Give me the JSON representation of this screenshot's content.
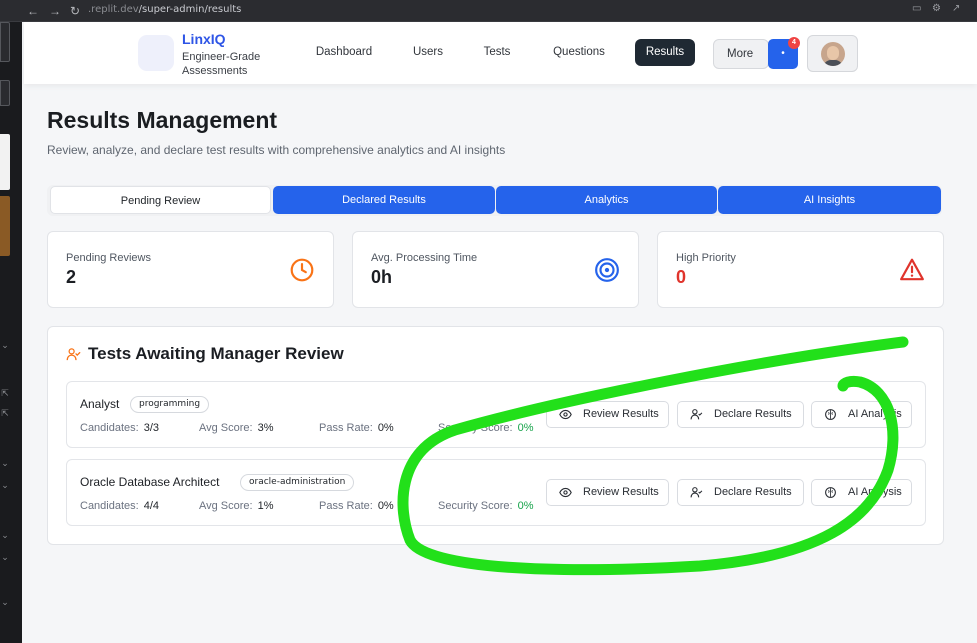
{
  "browser": {
    "url_prefix": ".replit.dev",
    "url_path": "/super-admin/results"
  },
  "brand": {
    "name": "LinxIQ",
    "tagline": "Engineer-Grade Assessments"
  },
  "nav": {
    "items": [
      "Dashboard",
      "Users",
      "Tests",
      "Questions",
      "Results"
    ],
    "active": "Results",
    "more_label": "More",
    "notification_count": "4",
    "notification_glyph": "•"
  },
  "page": {
    "title": "Results Management",
    "subtitle": "Review, analyze, and declare test results with comprehensive analytics and AI insights"
  },
  "tabs": [
    "Pending Review",
    "Declared Results",
    "Analytics",
    "AI Insights"
  ],
  "stats": [
    {
      "label": "Pending Reviews",
      "value": "2",
      "icon": "clock-icon",
      "color": "#f97316"
    },
    {
      "label": "Avg. Processing Time",
      "value": "0h",
      "icon": "target-icon",
      "color": "#2563eb"
    },
    {
      "label": "High Priority",
      "value": "0",
      "icon": "alert-triangle-icon",
      "color": "#e0342c"
    }
  ],
  "panel": {
    "title": "Tests Awaiting Manager Review",
    "icon": "user-check-icon"
  },
  "labels": {
    "candidates": "Candidates:",
    "avg_score": "Avg Score:",
    "pass_rate": "Pass Rate:",
    "security_score": "Security Score:",
    "review": "Review Results",
    "declare": "Declare Results",
    "ai": "AI Analysis"
  },
  "tests": [
    {
      "name": "Analyst",
      "tag": "programming",
      "candidates": "3/3",
      "avg_score": "3%",
      "pass_rate": "0%",
      "security_score": "0%"
    },
    {
      "name": "Oracle Database Architect",
      "tag": "oracle-administration",
      "candidates": "4/4",
      "avg_score": "1%",
      "pass_rate": "0%",
      "security_score": "0%"
    }
  ],
  "colors": {
    "accent": "#2563eb",
    "annotation": "#22e01a",
    "success": "#16a34a"
  }
}
